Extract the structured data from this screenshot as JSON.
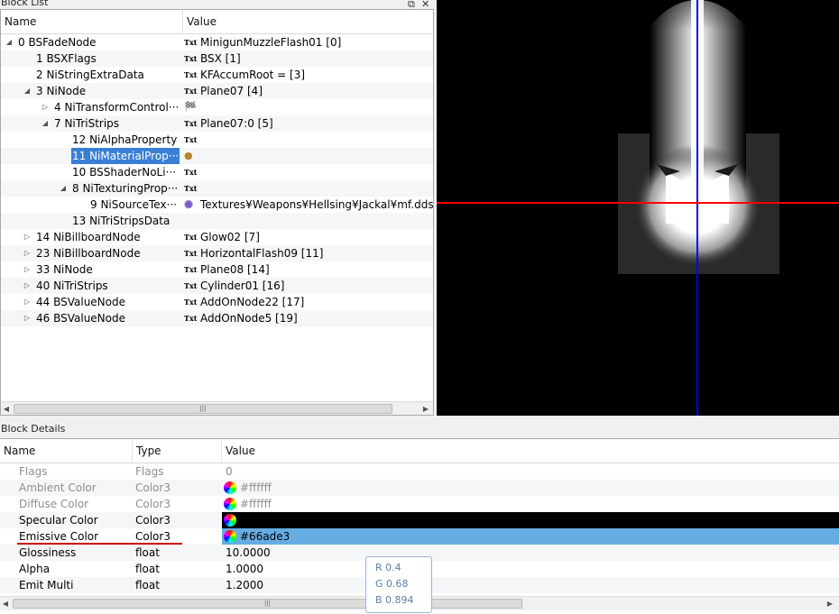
{
  "window": {
    "block_list_title": "Block List",
    "block_details_title": "Block Details"
  },
  "block_list": {
    "columns": {
      "name": "Name",
      "value": "Value"
    },
    "rows": [
      {
        "expander": "expanded",
        "label": "0 BSFadeNode",
        "value_icon": "txt-icon",
        "value": "MinigunMuzzleFlash01 [0]"
      },
      {
        "expander": "none",
        "label": "1 BSXFlags",
        "value_icon": "txt-icon",
        "value": "BSX [1]"
      },
      {
        "expander": "none",
        "label": "2 NiStringExtraData",
        "value_icon": "txt-icon",
        "value": "KFAccumRoot =   [3]"
      },
      {
        "expander": "expanded",
        "label": "3 NiNode",
        "value_icon": "txt-icon",
        "value": "Plane07 [4]"
      },
      {
        "expander": "collapsed",
        "label": "4 NiTransformControl···",
        "value_icon": "flag-icon",
        "value": ""
      },
      {
        "expander": "expanded",
        "label": "7 NiTriStrips",
        "value_icon": "txt-icon",
        "value": "Plane07:0 [5]"
      },
      {
        "expander": "none",
        "label": "12 NiAlphaProperty",
        "value_icon": "txt-icon",
        "value": ""
      },
      {
        "expander": "none",
        "label": "11 NiMaterialProp···",
        "value_icon": "palette-icon",
        "value": "",
        "selected": true
      },
      {
        "expander": "none",
        "label": "10 BSShaderNoLi···",
        "value_icon": "txt-icon",
        "value": ""
      },
      {
        "expander": "expanded",
        "label": "8 NiTexturingProp···",
        "value_icon": "txt-icon",
        "value": ""
      },
      {
        "expander": "none",
        "label": "9 NiSourceTex···",
        "value_icon": "gear-flower-icon",
        "value": "Textures¥Weapons¥Hellsing¥Jackal¥mf.dds ["
      },
      {
        "expander": "none",
        "label": "13 NiTriStripsData",
        "value_icon": "none",
        "value": ""
      },
      {
        "expander": "collapsed",
        "label": "14 NiBillboardNode",
        "value_icon": "txt-icon",
        "value": "Glow02 [7]"
      },
      {
        "expander": "collapsed",
        "label": "23 NiBillboardNode",
        "value_icon": "txt-icon",
        "value": "HorizontalFlash09 [11]"
      },
      {
        "expander": "collapsed",
        "label": "33 NiNode",
        "value_icon": "txt-icon",
        "value": "Plane08 [14]"
      },
      {
        "expander": "collapsed",
        "label": "40 NiTriStrips",
        "value_icon": "txt-icon",
        "value": "Cylinder01 [16]"
      },
      {
        "expander": "collapsed",
        "label": "44 BSValueNode",
        "value_icon": "txt-icon",
        "value": "AddOnNode22 [17]"
      },
      {
        "expander": "collapsed",
        "label": "46 BSValueNode",
        "value_icon": "txt-icon",
        "value": "AddOnNode5 [19]"
      }
    ],
    "txt_icon_text": "Txt"
  },
  "block_details": {
    "columns": {
      "name": "Name",
      "type": "Type",
      "value": "Value"
    },
    "rows": [
      {
        "name": "Flags",
        "type": "Flags",
        "value": "0",
        "disabled": true
      },
      {
        "name": "Ambient Color",
        "type": "Color3",
        "value": "#ffffff",
        "disabled": true,
        "color_wheel": true
      },
      {
        "name": "Diffuse Color",
        "type": "Color3",
        "value": "#ffffff",
        "disabled": true,
        "color_wheel": true
      },
      {
        "name": "Specular Color",
        "type": "Color3",
        "value": "",
        "color_wheel": true,
        "swatch_color": "#000000"
      },
      {
        "name": "Emissive Color",
        "type": "Color3",
        "value": "#66ade3",
        "color_wheel": true,
        "swatch_color": "#66ade3"
      },
      {
        "name": "Glossiness",
        "type": "float",
        "value": "10.0000"
      },
      {
        "name": "Alpha",
        "type": "float",
        "value": "1.0000"
      },
      {
        "name": "Emit Multi",
        "type": "float",
        "value": "1.2000"
      }
    ]
  },
  "tooltip": {
    "r": "R 0.4",
    "g": "G 0.68",
    "b": "B 0.894"
  },
  "colors": {
    "selection": "#3a7fd5",
    "emissive_row": "#66ade3",
    "axis_x": "#ff0000",
    "axis_y": "#0000ff",
    "underline": "#cc0000"
  }
}
